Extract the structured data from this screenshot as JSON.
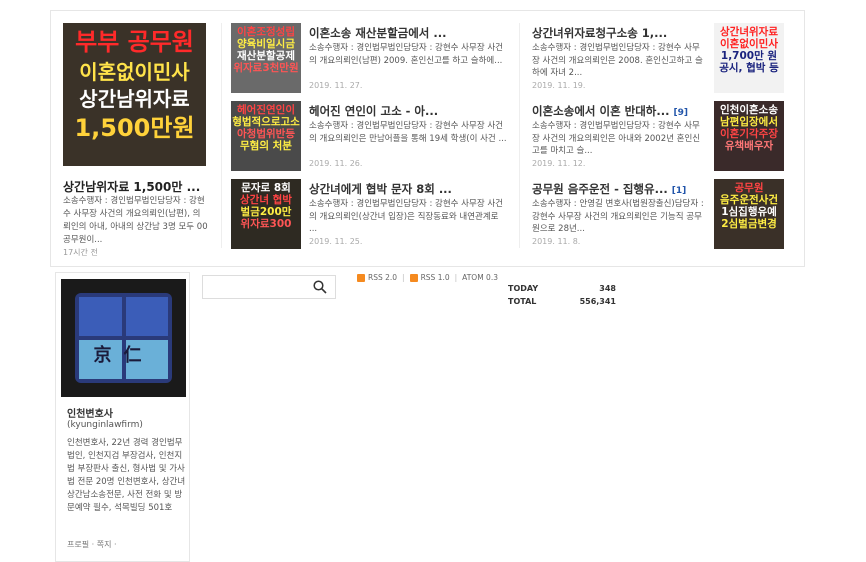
{
  "featured": {
    "thumb_lines": [
      "부부 공무원",
      "이혼없이민사",
      "상간남위자료",
      "1,500만원"
    ],
    "title": "상간남위자료 1,500만 ...",
    "summary": "소송수행자 : 경인법무법인담당자 : 강현수 사무장 사건의 개요의뢰인(남편), 의뢰인의 아내, 아내의 상간남 3명 모두 00공무원이...",
    "time": "17시간 전"
  },
  "posts": [
    {
      "thumb_lines": [
        "이혼조정성립",
        "양육비일시금",
        "재산분할공제",
        "위자료3천만원"
      ],
      "title": "이혼소송 재산분할금에서 ...",
      "summary": "소송수행자 : 경인법무법인담당자 : 강현수 사무장 사건의 개요의뢰인(남편) 2009. 혼인신고를 하고 슬하에...",
      "date": "2019. 11. 27."
    },
    {
      "thumb_lines": [
        "헤어진연인이",
        "형법적으로고소",
        "아청법위반등",
        "무혐의 처분"
      ],
      "title": "헤어진 연인이 고소 - 아...",
      "summary": "소송수행자 : 경인법무법인담당자 : 강현수 사무장 사건의 개요의뢰인은 만남어플을 통해 19세 학생(이 사건 ...",
      "date": "2019. 11. 26."
    },
    {
      "thumb_lines": [
        "문자로 8회",
        "상간녀 협박",
        "벌금200만",
        "위자료300"
      ],
      "title": "상간녀에게 협박 문자 8회 ...",
      "summary": "소송수행자 : 경인법무법인담당자 : 강현수 사무장 사건의 개요의뢰인(상간녀 입장)은 직장동료와 내연관계로 ...",
      "date": "2019. 11. 25."
    },
    {
      "thumb_lines": [
        "상간녀위자료",
        "이혼없이민사",
        "1,700만 원",
        "공시, 협박 등"
      ],
      "title": "상간녀위자료청구소송 1,...",
      "count": "",
      "summary": "소송수행자 : 경인법무법인담당자 : 강현수 사무장 사건의 개요의뢰인은 2008. 혼인신고하고 슬하에 자녀 2...",
      "date": "2019. 11. 19."
    },
    {
      "thumb_lines": [
        "인천이혼소송",
        "남편입장에서",
        "이혼기각주장",
        "유책배우자"
      ],
      "title": "이혼소송에서 이혼 반대하...",
      "count": "[9]",
      "summary": "소송수행자 : 경인법무법인담당자 : 강현수 사무장 사건의 개요의뢰인은 아내와 2002년 혼인신고를 마치고 슬...",
      "date": "2019. 11. 12."
    },
    {
      "thumb_lines": [
        "공무원",
        "음주운전사건",
        "1심집행유예",
        "2심벌금변경"
      ],
      "title": "공무원 음주운전 - 집행유...",
      "count": "[1]",
      "summary": "소송수행자 : 안영길 변호사(법원장출신)담당자 : 강현수 사무장 사건의 개요의뢰인은 기능직 공무원으로 28년...",
      "date": "2019. 11. 8."
    }
  ],
  "profile": {
    "logo_chars": "京仁",
    "name": "인천변호사",
    "id": "(kyunginlawfirm)",
    "description": "인천변호사, 22년 경력 경인법무법인, 인천지검 부장검사, 인천지법 부장판사 출신, 형사법 및 가사법 전문 20명 인천변호사, 상간녀상간남소송전문, 사전 전화 및 방문예약 필수, 석목빌딩 501호",
    "links": "프로필 · 쪽지 ·"
  },
  "search": {
    "placeholder": ""
  },
  "rss": {
    "rss2": "RSS 2.0",
    "rss1": "RSS 1.0",
    "atom": "ATOM 0.3"
  },
  "counter": {
    "today_label": "TODAY",
    "today_value": "348",
    "total_label": "TOTAL",
    "total_value": "556,341"
  },
  "colors": {
    "accent_red": "#ff2a2a",
    "accent_yellow": "#ffe34a",
    "rss_orange": "#f58a1f"
  }
}
